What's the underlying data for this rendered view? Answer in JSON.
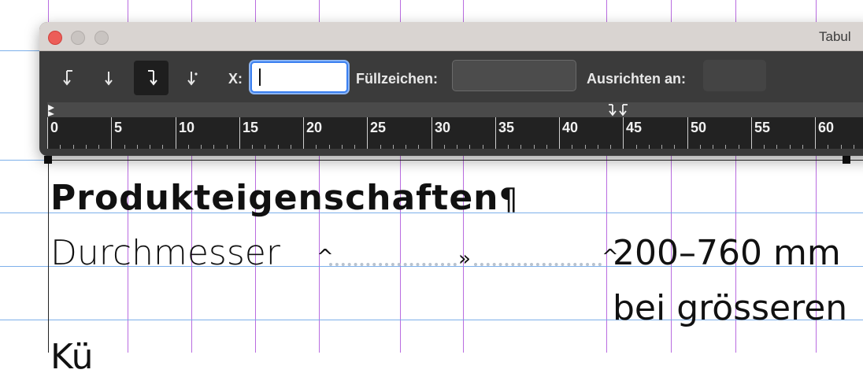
{
  "panel": {
    "title": "Tabul",
    "window_buttons": [
      "close",
      "minimize",
      "zoom"
    ],
    "tab_types": [
      {
        "name": "left-justified-tab-icon",
        "active": false
      },
      {
        "name": "center-justified-tab-icon",
        "active": false
      },
      {
        "name": "right-justified-tab-icon",
        "active": true
      },
      {
        "name": "align-to-decimal-tab-icon",
        "active": false
      }
    ],
    "x_label": "X:",
    "x_value": "",
    "leader_label": "Füllzeichen:",
    "leader_value": "",
    "align_label": "Ausrichten an:",
    "align_value": ""
  },
  "ruler": {
    "unit_labels": [
      "0",
      "5",
      "10",
      "15",
      "20",
      "25",
      "30",
      "35",
      "40",
      "45",
      "50",
      "55",
      "60"
    ]
  },
  "document": {
    "heading": "Produkteigenschaften",
    "pilcrow": "¶",
    "line1_label": "Durchmesser",
    "line1_tab_mark": "^",
    "line1_mid_mark": "»",
    "line1_value": "200–760 mm",
    "line2": "bei grösseren",
    "line3": "Kü"
  },
  "colors": {
    "guide_vertical": "#a23bd6",
    "guide_horizontal": "#6fa7e8",
    "panel_bg": "#3b3b3b",
    "close_button": "#ec5d58",
    "input_focus": "#3a7ff0"
  }
}
